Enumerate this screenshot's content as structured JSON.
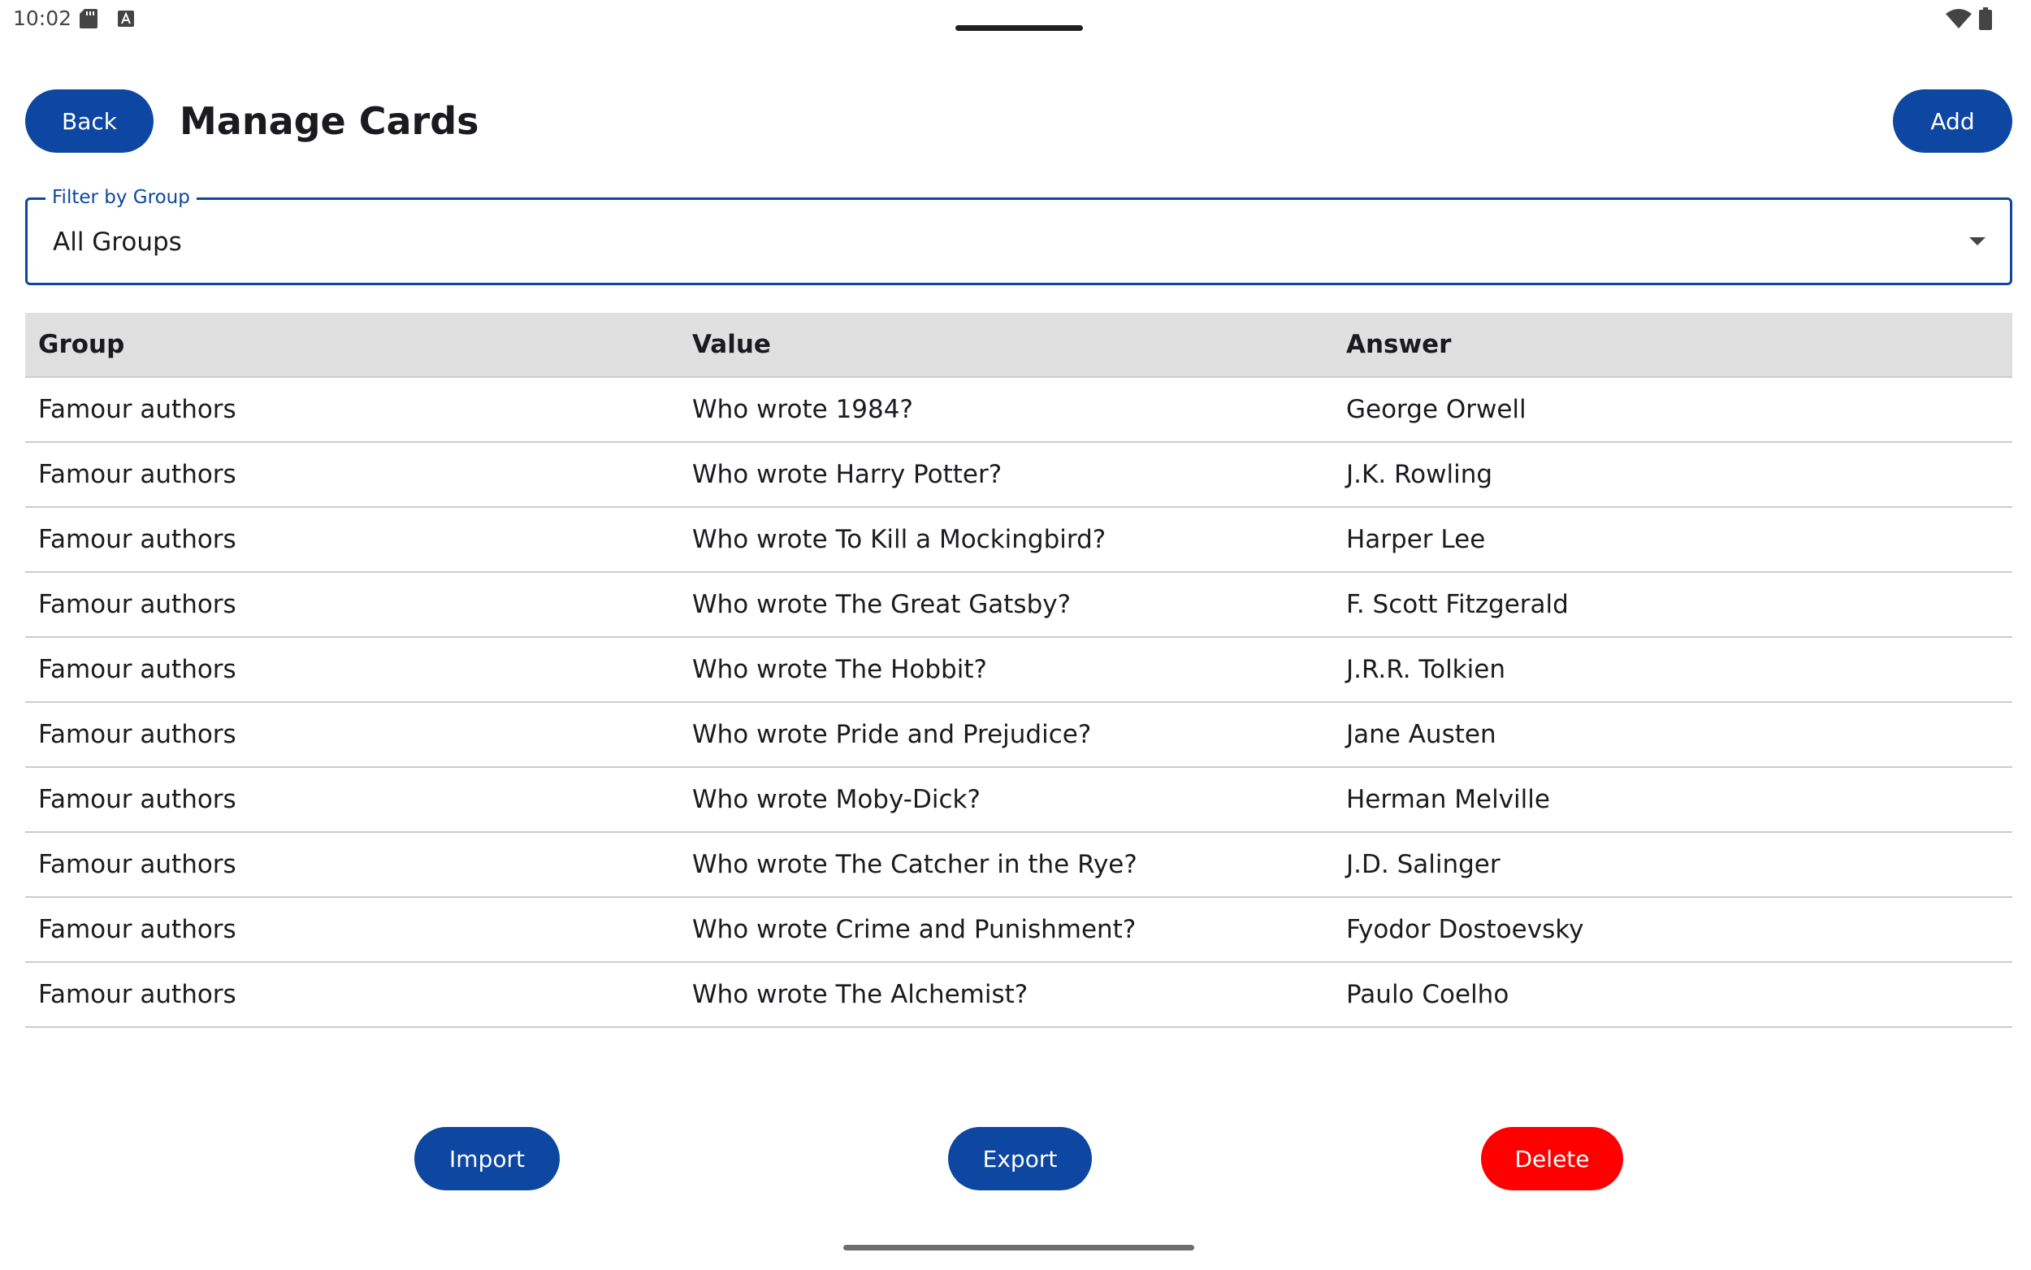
{
  "status_bar": {
    "time": "10:02"
  },
  "header": {
    "back_label": "Back",
    "title": "Manage Cards",
    "add_label": "Add"
  },
  "filter": {
    "label": "Filter by Group",
    "value": "All Groups"
  },
  "table": {
    "columns": [
      "Group",
      "Value",
      "Answer"
    ],
    "rows": [
      [
        "Famour authors",
        "Who wrote 1984?",
        "George Orwell"
      ],
      [
        "Famour authors",
        "Who wrote Harry Potter?",
        "J.K. Rowling"
      ],
      [
        "Famour authors",
        "Who wrote To Kill a Mockingbird?",
        "Harper Lee"
      ],
      [
        "Famour authors",
        "Who wrote The Great Gatsby?",
        "F. Scott Fitzgerald"
      ],
      [
        "Famour authors",
        "Who wrote The Hobbit?",
        "J.R.R. Tolkien"
      ],
      [
        "Famour authors",
        "Who wrote Pride and Prejudice?",
        "Jane Austen"
      ],
      [
        "Famour authors",
        "Who wrote Moby-Dick?",
        "Herman Melville"
      ],
      [
        "Famour authors",
        "Who wrote The Catcher in the Rye?",
        "J.D. Salinger"
      ],
      [
        "Famour authors",
        "Who wrote Crime and Punishment?",
        "Fyodor Dostoevsky"
      ],
      [
        "Famour authors",
        "Who wrote The Alchemist?",
        "Paulo Coelho"
      ]
    ]
  },
  "actions": {
    "import_label": "Import",
    "export_label": "Export",
    "delete_label": "Delete"
  },
  "colors": {
    "primary": "#0d47a1",
    "danger": "#ff0000",
    "header_bg": "#e0e0e0"
  },
  "icons": [
    "sd-card-icon",
    "a-icon",
    "wifi-icon",
    "battery-icon",
    "dropdown-arrow-icon"
  ]
}
